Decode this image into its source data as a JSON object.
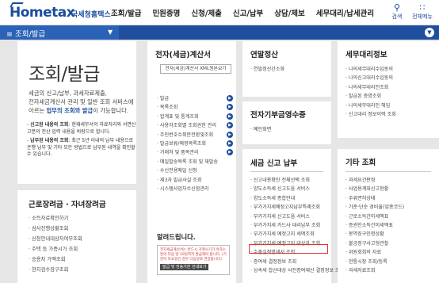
{
  "header": {
    "logo_main": "Hom",
    "logo_tax": "etax",
    "logo_name": "국세청홈택스",
    "nav": [
      "조회/발급",
      "민원증명",
      "신청/제출",
      "신고/납부",
      "상담/제보",
      "세무대리/납세관리"
    ],
    "search_label": "검색",
    "allmenu_label": "전체메뉴"
  },
  "bluebar": {
    "menu_label": "≡  조회/발급"
  },
  "left": {
    "title": "조회/발급",
    "desc_1": "세금의 신고/납부, 과세자료제출,",
    "desc_2": "전자세금계산서 관리 및 일반 조회 서비스에",
    "desc_3a": "아르는 ",
    "desc_3b": "업무의 조회와 발급",
    "desc_3c": "이 가능합니다.",
    "note1_bold": "신고된 내용의 조회",
    "note1_rest": ": 현재세무서의 자료처리와 서면신고분의 전산 입력 내용을 바탕으로 합니다.",
    "note2_bold": "납부된 내용의 조회",
    "note2_rest": ": 최근 5년 이내의 납부 내용으로 은행 납부 및 기타 모든 방법으로 납부된 내역을 확인할 수 있습니다.",
    "sub_title": "근로장려금 · 자녀장려금",
    "sub_items": [
      "소득자료확인하기",
      "심사진행상황조회",
      "신청안내대상자여부조회",
      "주택 등 가증시가 조회",
      "승용차 가액조회",
      "현지검수장구조회"
    ]
  },
  "einvoice": {
    "title": "전자(세금)계산서",
    "button": "전자(세금)계산서 XML원본보기",
    "items": [
      "발급",
      "목록조회",
      "합계표 및 통계조회",
      "사용자조회별 조회권한 관리",
      "주민번호수취분전환및조회",
      "발급보류/예정목록조회",
      "거래처 및 품목관리",
      "매일발송목록 조회 및 재발송",
      "수신전용메일 신청",
      "제3자 발급사실 조회",
      "시스템사업자수신함관리"
    ],
    "alert_title": "알려드립니다.",
    "alert_body": "전자세금계산서는 반드시 거래시기가 속하는 달의 다음 달 10일까지 발급해야 합니다. (기한이 토요일인 경우 다음날로 연장합니다)",
    "alert_button": "발급 및 전송기한 안내보기"
  },
  "yearend": {
    "title": "연말정산",
    "items": [
      "연말정산간소화"
    ]
  },
  "cashreceipt": {
    "title": "전자기부금영수증",
    "items": [
      "예인화면"
    ]
  },
  "taxreturn": {
    "title": "세금 신고 납부",
    "items": [
      "신고내용확인 전체선택 조회",
      "양도소득세 신고도움 서비스",
      "양도소득세 종합안내",
      "부가가치세예정고지납부특례조회",
      "부가가치세 신고도움 서비스",
      "부가가치세 카드사 대리납부 조회",
      "부가가치세 예정고지 세액조회",
      "부가가치세 예정고지 대상자 조회",
      "수출실적명세서 조회",
      "증여세 결정정보 조회",
      "상속세 합산대상 사전증여재산 결정정보 조회"
    ],
    "highlight_item": "수출실적명세서 조회"
  },
  "taxagent": {
    "title": "세무대리정보",
    "items": [
      "나의세무대리수임동의",
      "나의신고대리수임동의",
      "나의세무대리인조회",
      "발급된 증명조회",
      "나의세무대리인 해임",
      "신고대리 정보이력 조회"
    ]
  },
  "other": {
    "title": "기타 조회",
    "items": [
      "과세요건판정",
      "사업용계좌신고현황",
      "주류면허상태",
      "기준·단순 경비율(업종코드)",
      "근로소득간이세액표",
      "증권인소득간이세액표",
      "봉역징구인명상황",
      "불공정구사고형관찰",
      "위원회회의 자료",
      "전통시장 조회/등록",
      "과세자료조회"
    ]
  },
  "colors": {
    "brand": "#1f4e9e",
    "highlight": "#e23030"
  }
}
